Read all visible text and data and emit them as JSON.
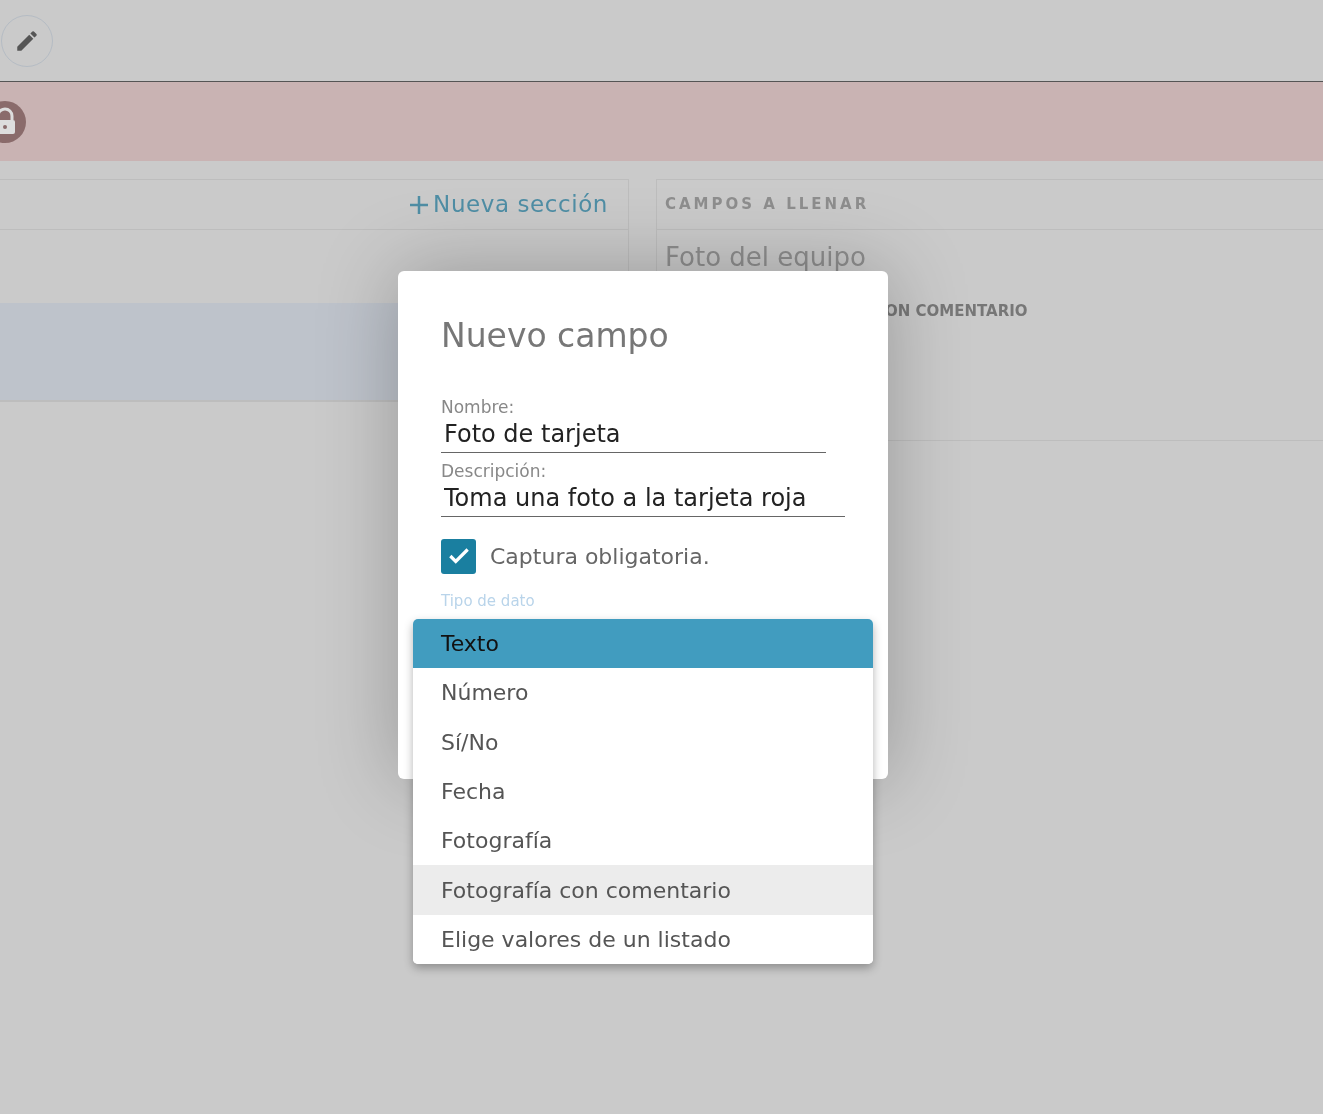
{
  "sections_panel": {
    "new_section_button": "Nueva sección"
  },
  "fields_panel": {
    "heading": "CAMPOS A LLENAR",
    "field_name": "Foto del equipo",
    "field_type": "ON COMENTARIO"
  },
  "dialog": {
    "title": "Nuevo campo",
    "fields": [
      {
        "label": "Nombre:",
        "value": "Foto de tarjeta"
      },
      {
        "label": "Descripción:",
        "value": "Toma una foto a la tarjeta roja"
      }
    ],
    "required": {
      "label": "Captura obligatoria.",
      "checked": true
    },
    "data_type": {
      "label": "Tipo de dato"
    }
  },
  "dropdown": {
    "options": [
      {
        "label": "Texto",
        "selected": true,
        "highlighted": false
      },
      {
        "label": "Número",
        "selected": false,
        "highlighted": false
      },
      {
        "label": "Sí/No",
        "selected": false,
        "highlighted": false
      },
      {
        "label": "Fecha",
        "selected": false,
        "highlighted": false
      },
      {
        "label": "Fotografía",
        "selected": false,
        "highlighted": false
      },
      {
        "label": "Fotografía con comentario",
        "selected": false,
        "highlighted": true
      },
      {
        "label": "Elige valores de un listado",
        "selected": false,
        "highlighted": false
      }
    ]
  }
}
